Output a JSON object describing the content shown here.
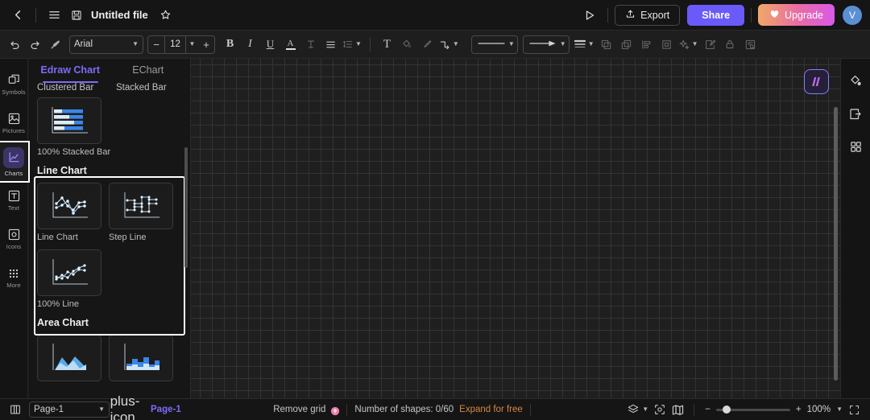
{
  "header": {
    "back_icon": "chevron-left-icon",
    "menu_icon": "hamburger-menu-icon",
    "save_icon": "save-floppy-icon",
    "title": "Untitled file",
    "favorite_icon": "star-icon",
    "present_icon": "play-triangle-icon",
    "export_label": "Export",
    "export_icon": "upload-icon",
    "share_label": "Share",
    "upgrade_label": "Upgrade",
    "upgrade_icon": "heart-icon",
    "avatar_initial": "V",
    "colors": {
      "share_bg": "#6a5af9",
      "upgrade_gradient_start": "#f0a868",
      "upgrade_gradient_end": "#d95ae8",
      "avatar_bg": "#5b8fd4"
    }
  },
  "toolbar": {
    "undo_icon": "undo-arrow-icon",
    "redo_icon": "redo-arrow-icon",
    "format_painter_icon": "format-painter-icon",
    "font_family": "Arial",
    "font_size": "12",
    "decrease_label": "−",
    "increase_label": "+",
    "bold_label": "B",
    "italic_label": "I",
    "underline_label": "U",
    "font_color_label": "A",
    "strikethrough_icon": "text-strikethrough-icon",
    "align_icon": "align-left-icon",
    "line_spacing_icon": "line-spacing-icon",
    "text_box_label": "T",
    "fill_icon": "fill-color-icon",
    "pen_icon": "pen-line-color-icon",
    "connector_icon": "connector-icon",
    "line_style_icon": "line-style-icon",
    "arrow_style_icon": "arrow-style-icon",
    "line_weight_icon": "line-weight-icon",
    "bring_front_icon": "bring-to-front-icon",
    "send_back_icon": "send-to-back-icon",
    "align_objects_icon": "align-objects-icon",
    "group_icon": "group-objects-icon",
    "effects_icon": "magic-effects-icon",
    "edit_shape_icon": "edit-shape-icon",
    "lock_icon": "lock-icon",
    "find_icon": "find-replace-icon"
  },
  "left_rail": {
    "items": [
      {
        "label": "Symbols",
        "icon": "symbols-shapes-icon",
        "active": false
      },
      {
        "label": "Pictures",
        "icon": "picture-image-icon",
        "active": false
      },
      {
        "label": "Charts",
        "icon": "line-chart-icon",
        "active": true
      },
      {
        "label": "Text",
        "icon": "text-box-icon",
        "active": false
      },
      {
        "label": "Icons",
        "icon": "icons-grid-icon",
        "active": false
      },
      {
        "label": "More",
        "icon": "more-dots-icon",
        "active": false
      }
    ]
  },
  "panel": {
    "tabs": [
      {
        "label": "Edraw Chart",
        "active": true
      },
      {
        "label": "EChart",
        "active": false
      }
    ],
    "clipped_labels": [
      "Clustered Bar",
      "Stacked Bar"
    ],
    "sections": [
      {
        "title": "",
        "highlighted": false,
        "items": [
          {
            "label": "100% Stacked Bar",
            "thumb": "stacked-bar-100-thumb"
          }
        ]
      },
      {
        "title": "Line Chart",
        "highlighted": true,
        "items": [
          {
            "label": "Line Chart",
            "thumb": "line-chart-thumb"
          },
          {
            "label": "Step Line",
            "thumb": "step-line-thumb"
          },
          {
            "label": "100% Line",
            "thumb": "line-100-thumb"
          }
        ]
      },
      {
        "title": "Area Chart",
        "highlighted": false,
        "items": [
          {
            "label": "",
            "thumb": "area-chart-thumb"
          },
          {
            "label": "",
            "thumb": "stacked-area-thumb"
          }
        ]
      }
    ]
  },
  "canvas": {
    "ai_button_icon": "ai-sparkle-icon",
    "grid_size": 15,
    "grid_color": "#333333",
    "background": "#1f1f1f"
  },
  "right_rail": {
    "items": [
      {
        "icon": "fill-bucket-icon"
      },
      {
        "icon": "page-layout-icon"
      },
      {
        "icon": "grid-apps-icon"
      }
    ],
    "bottom_icon": "settings-list-icon"
  },
  "status": {
    "panel_toggle_icon": "toggle-panel-icon",
    "page_selected": "Page-1",
    "add_page_icon": "plus-icon",
    "page_tab_label": "Page-1",
    "remove_grid_label": "Remove grid",
    "remove_grid_badge_icon": "diamond-gem-icon",
    "shapes_count_label": "Number of shapes: 0/60",
    "expand_link": "Expand for free",
    "layers_icon": "layers-icon",
    "focus_icon": "focus-frame-icon",
    "map_icon": "minimap-icon",
    "zoom_minus": "−",
    "zoom_plus": "+",
    "zoom_level": "100%",
    "fullscreen_icon": "fullscreen-icon",
    "colors": {
      "link": "#d6883f",
      "page_tab": "#7b6cf6"
    }
  }
}
